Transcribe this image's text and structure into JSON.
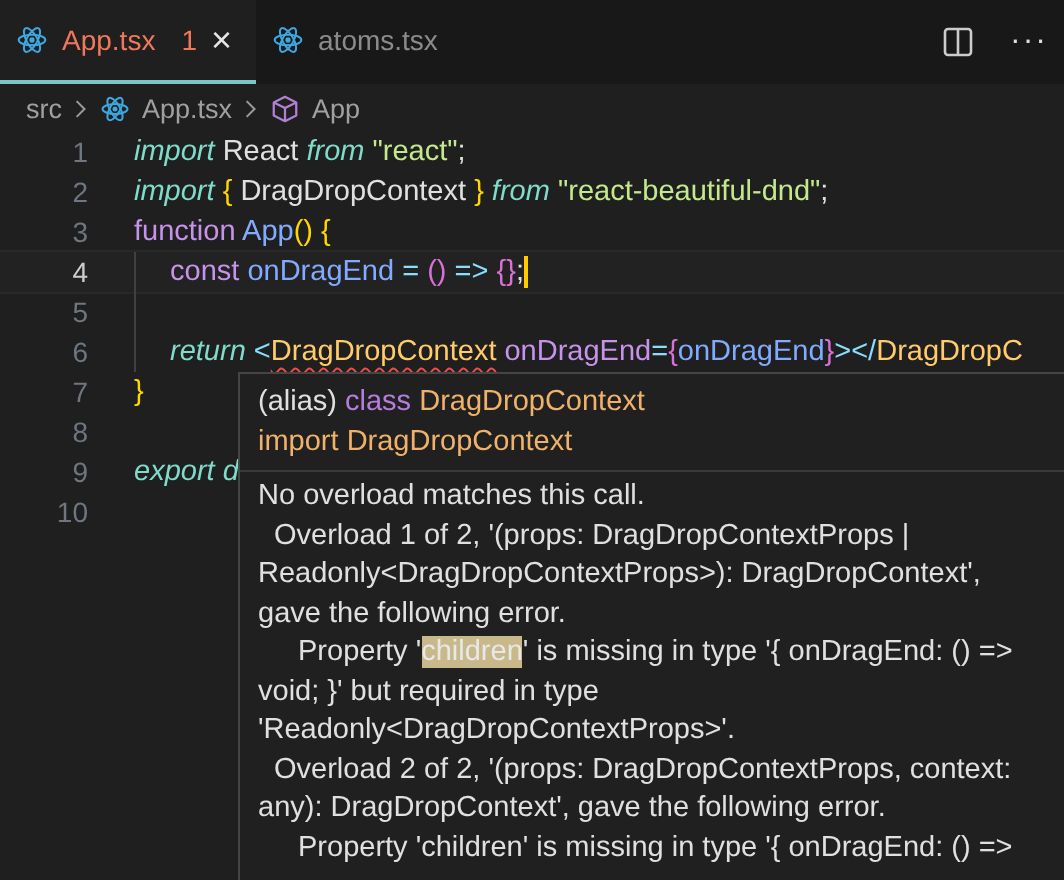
{
  "tabs": [
    {
      "label": "App.tsx",
      "selected": true,
      "error": true,
      "problem_count": "1",
      "close": "×"
    },
    {
      "label": "atoms.tsx",
      "selected": false,
      "error": false
    }
  ],
  "toolbar": {
    "more": "···"
  },
  "breadcrumb": [
    {
      "label": "src",
      "kind": "folder"
    },
    {
      "label": "App.tsx",
      "kind": "file"
    },
    {
      "label": "App",
      "kind": "symbol"
    }
  ],
  "code_lines": [
    {
      "number": "1",
      "indented": false,
      "active": false,
      "tokens": [
        {
          "text": "import",
          "kind": "kwi"
        },
        {
          "text": " React ",
          "kind": "plain"
        },
        {
          "text": "from",
          "kind": "kwi"
        },
        {
          "text": " \"react\"",
          "kind": "str"
        },
        {
          "text": ";",
          "kind": "plain"
        }
      ]
    },
    {
      "number": "2",
      "indented": false,
      "active": false,
      "tokens": [
        {
          "text": "import",
          "kind": "kwi"
        },
        {
          "text": " {",
          "kind": "br1"
        },
        {
          "text": " DragDropContext ",
          "kind": "ident"
        },
        {
          "text": "}",
          "kind": "br1"
        },
        {
          "text": " from",
          "kind": "kwi"
        },
        {
          "text": " \"react-beautiful-dnd\"",
          "kind": "str"
        },
        {
          "text": ";",
          "kind": "plain"
        }
      ]
    },
    {
      "number": "3",
      "indented": false,
      "active": false,
      "tokens": [
        {
          "text": "function",
          "kind": "kw"
        },
        {
          "text": " App",
          "kind": "fn"
        },
        {
          "text": "()",
          "kind": "br1"
        },
        {
          "text": " {",
          "kind": "br1"
        }
      ]
    },
    {
      "number": "4",
      "indented": true,
      "active": true,
      "cursor": true,
      "tokens": [
        {
          "text": "const",
          "kind": "kw"
        },
        {
          "text": " onDragEnd",
          "kind": "fn"
        },
        {
          "text": " = ",
          "kind": "op"
        },
        {
          "text": "()",
          "kind": "br2"
        },
        {
          "text": " => ",
          "kind": "op"
        },
        {
          "text": "{}",
          "kind": "br2"
        },
        {
          "text": ";",
          "kind": "plain"
        }
      ]
    },
    {
      "number": "5",
      "indented": true,
      "active": false
    },
    {
      "number": "6",
      "indented": true,
      "active": false,
      "tokens": [
        {
          "text": "return",
          "kind": "kwi"
        },
        {
          "text": " <",
          "kind": "op"
        },
        {
          "text": "DragDropContext",
          "kind": "tag",
          "error": true
        },
        {
          "text": " onDragEnd",
          "kind": "attr"
        },
        {
          "text": "=",
          "kind": "op"
        },
        {
          "text": "{",
          "kind": "br2"
        },
        {
          "text": "onDragEnd",
          "kind": "fn"
        },
        {
          "text": "}",
          "kind": "br2"
        },
        {
          "text": "></",
          "kind": "op"
        },
        {
          "text": "DragDropC",
          "kind": "tag"
        }
      ]
    },
    {
      "number": "7",
      "indented": false,
      "active": false,
      "tokens": [
        {
          "text": "}",
          "kind": "br1"
        }
      ]
    },
    {
      "number": "8",
      "indented": false,
      "active": false
    },
    {
      "number": "9",
      "indented": false,
      "active": false,
      "tokens": [
        {
          "text": "export d",
          "kind": "kwi"
        }
      ]
    },
    {
      "number": "10",
      "indented": false,
      "active": false
    }
  ],
  "hover": {
    "signature": [
      [
        {
          "text": "(alias) ",
          "kind": "plain"
        },
        {
          "text": "class",
          "kind": "kw"
        },
        {
          "text": " DragDropContext",
          "kind": "cls"
        }
      ],
      [
        {
          "text": "import DragDropContext",
          "kind": "cls"
        }
      ]
    ],
    "message": [
      {
        "kind": "text",
        "parts": [
          {
            "text": "No overload matches this call."
          }
        ]
      },
      {
        "kind": "indent1",
        "parts": [
          {
            "text": "Overload 1 of 2, '(props: DragDropContextProps |"
          }
        ]
      },
      {
        "kind": "text",
        "parts": [
          {
            "text": "Readonly<DragDropContextProps>): DragDropContext',"
          }
        ]
      },
      {
        "kind": "text",
        "parts": [
          {
            "text": "gave the following error."
          }
        ]
      },
      {
        "kind": "indent2",
        "parts": [
          {
            "text": "Property '"
          },
          {
            "text": "children",
            "highlighted": true
          },
          {
            "text": "' is missing in type '{ onDragEnd: () =>"
          }
        ]
      },
      {
        "kind": "text",
        "parts": [
          {
            "text": "void; }' but required in type"
          }
        ]
      },
      {
        "kind": "text",
        "parts": [
          {
            "text": "'Readonly<DragDropContextProps>'."
          }
        ]
      },
      {
        "kind": "indent1",
        "parts": [
          {
            "text": "Overload 2 of 2, '(props: DragDropContextProps, context:"
          }
        ]
      },
      {
        "kind": "text",
        "parts": [
          {
            "text": "any): DragDropContext', gave the following error."
          }
        ]
      },
      {
        "kind": "indent2",
        "parts": [
          {
            "text": "Property 'children' is missing in type '{ onDragEnd: () =>"
          }
        ]
      }
    ]
  }
}
